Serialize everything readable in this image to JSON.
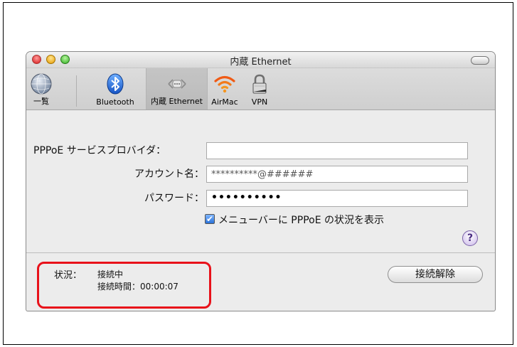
{
  "window": {
    "title": "内蔵 Ethernet"
  },
  "toolbar": {
    "items": [
      {
        "label": "一覧",
        "icon": "globe-icon"
      },
      {
        "label": "Bluetooth",
        "icon": "bluetooth-icon"
      },
      {
        "label": "内蔵 Ethernet",
        "icon": "ethernet-icon"
      },
      {
        "label": "AirMac",
        "icon": "airmac-icon"
      },
      {
        "label": "VPN",
        "icon": "lock-icon"
      }
    ]
  },
  "form": {
    "service_provider_label": "PPPoE サービスプロバイダ：",
    "service_provider_value": "",
    "account_label": "アカウント名：",
    "account_value": "**********@######",
    "password_label": "パスワード：",
    "password_value": "••••••••••",
    "menubar_checkbox_label": "メニューバーに PPPoE の状況を表示",
    "menubar_checked": true
  },
  "status": {
    "label": "状況：",
    "state": "接続中",
    "time": "接続時間：00:00:07"
  },
  "buttons": {
    "disconnect": "接続解除",
    "help": "?"
  },
  "colors": {
    "highlight": "#e8111a",
    "checkbox": "#2a72d8"
  }
}
